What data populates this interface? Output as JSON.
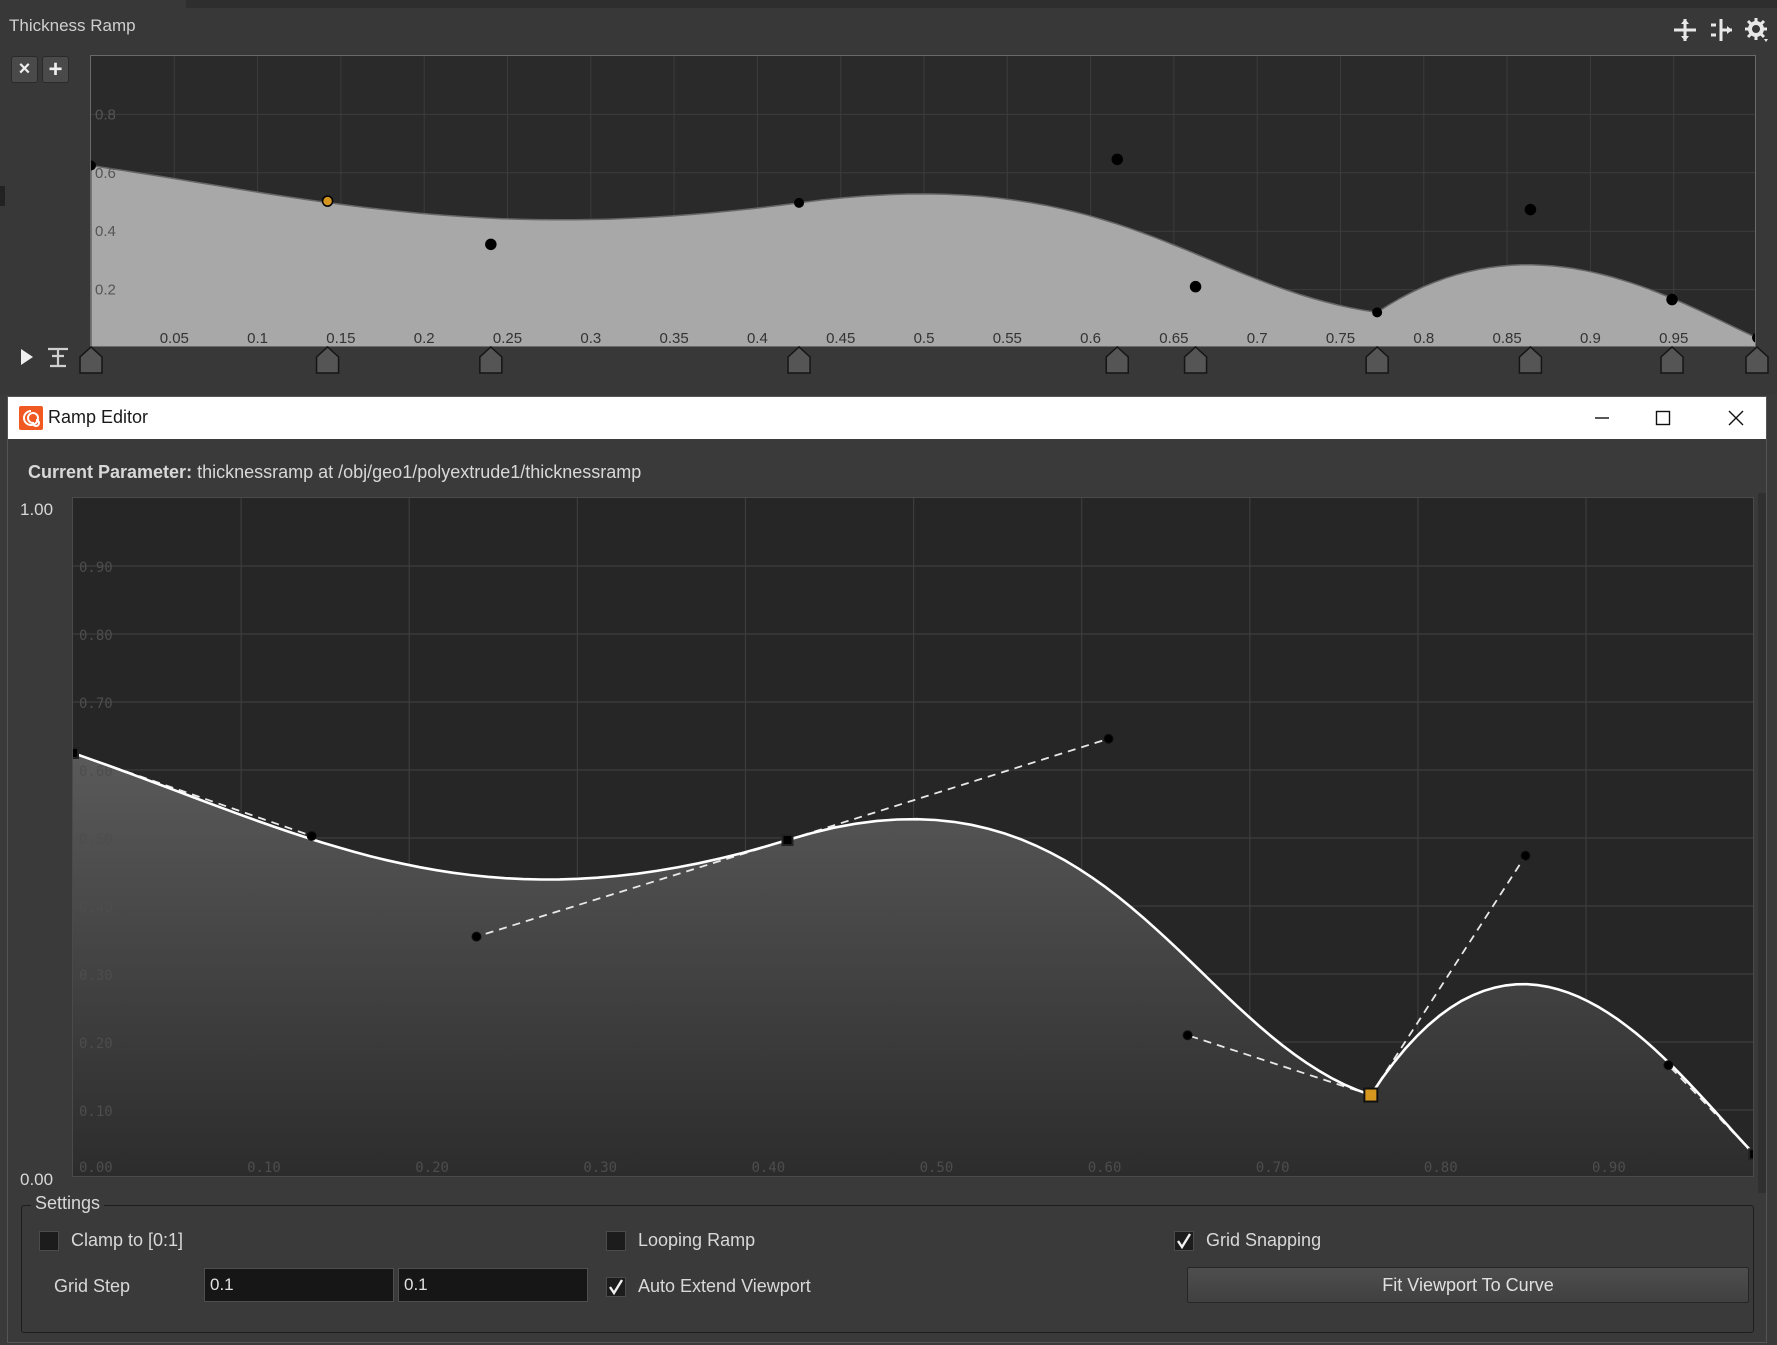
{
  "ramp_panel": {
    "title": "Thickness Ramp",
    "x_ticks": [
      "0.05",
      "0.1",
      "0.15",
      "0.2",
      "0.25",
      "0.3",
      "0.35",
      "0.4",
      "0.45",
      "0.5",
      "0.55",
      "0.6",
      "0.65",
      "0.7",
      "0.75",
      "0.8",
      "0.85",
      "0.9",
      "0.95"
    ],
    "y_ticks": [
      "0.8",
      "0.6",
      "0.4",
      "0.2"
    ],
    "buttons": {
      "remove": "×",
      "add": "+"
    },
    "icons": [
      "snap-icon",
      "frame-icon",
      "gear-icon"
    ]
  },
  "ramp_editor": {
    "window_title": "Ramp Editor",
    "current_parameter_label": "Current Parameter:",
    "current_parameter_value": "thicknessramp at /obj/geo1/polyextrude1/thicknessramp",
    "y_max_label": "1.00",
    "y_min_label": "0.00",
    "grid_y_labels": [
      "0.90",
      "0.80",
      "0.70",
      "0.60",
      "0.50",
      "0.40",
      "0.30",
      "0.20",
      "0.10"
    ],
    "grid_x_labels": [
      "0.00",
      "0.10",
      "0.20",
      "0.30",
      "0.40",
      "0.50",
      "0.60",
      "0.70",
      "0.80",
      "0.90"
    ]
  },
  "settings": {
    "legend": "Settings",
    "clamp_label": "Clamp to [0:1]",
    "clamp_checked": false,
    "looping_label": "Looping Ramp",
    "looping_checked": false,
    "grid_snapping_label": "Grid Snapping",
    "grid_snapping_checked": true,
    "auto_extend_label": "Auto Extend Viewport",
    "auto_extend_checked": true,
    "grid_step_label": "Grid Step",
    "grid_step_x": "0.1",
    "grid_step_y": "0.1",
    "fit_button_label": "Fit Viewport To Curve"
  },
  "curve": {
    "keys": [
      {
        "x": 0.0,
        "y": 0.625
      },
      {
        "x": 0.425,
        "y": 0.497
      },
      {
        "x": 0.772,
        "y": 0.122
      },
      {
        "x": 1.0,
        "y": 0.035
      }
    ],
    "handles": [
      {
        "x": 0.142,
        "y": 0.503,
        "selected": true
      },
      {
        "x": 0.24,
        "y": 0.355
      },
      {
        "x": 0.616,
        "y": 0.646
      },
      {
        "x": 0.663,
        "y": 0.21
      },
      {
        "x": 0.864,
        "y": 0.474
      },
      {
        "x": 0.949,
        "y": 0.166
      }
    ],
    "selected_key_index": 2,
    "fill_color": "#a8a8a8",
    "line_color": "#ffffff",
    "selected_color": "#d4961e"
  }
}
